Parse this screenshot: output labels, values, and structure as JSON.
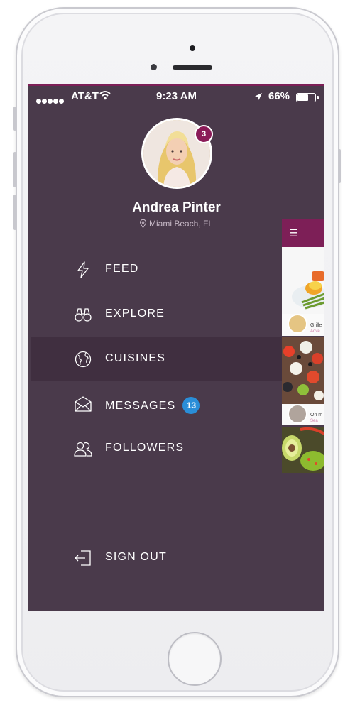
{
  "status_bar": {
    "carrier": "AT&T",
    "time": "9:23 AM",
    "battery_percent": "66%",
    "battery_level": 0.66
  },
  "profile": {
    "name": "Andrea Pinter",
    "location": "Miami Beach, FL",
    "notification_count": "3"
  },
  "menu": {
    "items": [
      {
        "label": "FEED",
        "icon": "lightning-icon"
      },
      {
        "label": "EXPLORE",
        "icon": "binoculars-icon"
      },
      {
        "label": "CUISINES",
        "icon": "globe-icon",
        "active": true
      },
      {
        "label": "MESSAGES",
        "icon": "envelope-icon",
        "badge": "13"
      },
      {
        "label": "FOLLOWERS",
        "icon": "people-icon"
      }
    ],
    "sign_out": {
      "label": "SIGN OUT",
      "icon": "sign-out-icon"
    }
  },
  "peek": {
    "header_icon": "hamburger-menu-icon",
    "cards": [
      {
        "caption": "Grille",
        "sub": "Adve"
      },
      {
        "caption": "On m",
        "sub": "Sea"
      },
      {
        "caption": "",
        "sub": ""
      }
    ]
  },
  "colors": {
    "drawer_bg": "#4a3a4b",
    "active_row": "#402f40",
    "accent": "#7d1f57",
    "badge_blue": "#2a8ed8"
  }
}
